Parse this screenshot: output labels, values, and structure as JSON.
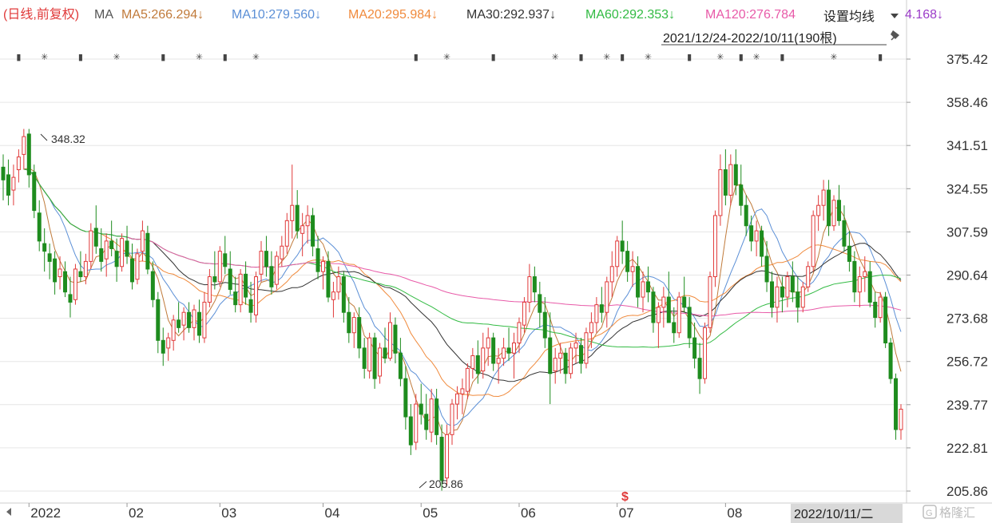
{
  "chart_data": {
    "type": "candlestick",
    "title": "(日线,前复权)",
    "ma_label": "MA",
    "ma_lines": [
      {
        "label": "MA5:266.294↓",
        "value": 266.294,
        "color": "#c07a3a"
      },
      {
        "label": "MA10:279.560↓",
        "value": 279.56,
        "color": "#5b8fd6"
      },
      {
        "label": "MA20:295.984↓",
        "value": 295.984,
        "color": "#f08a3c"
      },
      {
        "label": "MA30:292.937↓",
        "value": 292.937,
        "color": "#333333"
      },
      {
        "label": "MA60:292.353↓",
        "value": 292.353,
        "color": "#33bb44"
      },
      {
        "label": "MA120:276.784",
        "value": 276.784,
        "color": "#e85aa8"
      }
    ],
    "ma250_fragment": "4.168↓",
    "settings_label": "设置均线",
    "date_range": "2021/12/24-2022/10/11(190根)",
    "y_ticks": [
      "375.42",
      "358.46",
      "341.51",
      "324.55",
      "307.59",
      "290.64",
      "273.68",
      "256.72",
      "239.77",
      "222.81",
      "205.86"
    ],
    "ylim": [
      205.86,
      375.42
    ],
    "x_labels": [
      "2022",
      "02",
      "03",
      "04",
      "05",
      "06",
      "07",
      "08"
    ],
    "current_date_label": "2022/10/11/二",
    "high_annotation": "348.32",
    "low_annotation": "205.86",
    "dividend_mark": "$",
    "watermark": "格隆汇",
    "colors": {
      "up": "#e03a3a",
      "down": "#1e8c1e",
      "grid": "#e6e6e6",
      "axis_text": "#333333"
    },
    "candles": [
      [
        333,
        338,
        320,
        328
      ],
      [
        330,
        336,
        318,
        322
      ],
      [
        324,
        334,
        318,
        329
      ],
      [
        332,
        340,
        327,
        337
      ],
      [
        338,
        348,
        332,
        345
      ],
      [
        346,
        348,
        325,
        330
      ],
      [
        331,
        334,
        313,
        316
      ],
      [
        315,
        320,
        300,
        304
      ],
      [
        303,
        309,
        292,
        300
      ],
      [
        299,
        303,
        289,
        296
      ],
      [
        297,
        300,
        283,
        288
      ],
      [
        290,
        298,
        285,
        293
      ],
      [
        292,
        296,
        282,
        284
      ],
      [
        283,
        290,
        274,
        280
      ],
      [
        281,
        295,
        279,
        293
      ],
      [
        292,
        300,
        288,
        290
      ],
      [
        290,
        299,
        287,
        296
      ],
      [
        296,
        311,
        293,
        308
      ],
      [
        309,
        318,
        299,
        302
      ],
      [
        301,
        309,
        292,
        296
      ],
      [
        297,
        307,
        290,
        304
      ],
      [
        304,
        312,
        298,
        301
      ],
      [
        300,
        305,
        288,
        294
      ],
      [
        294,
        307,
        292,
        305
      ],
      [
        304,
        310,
        295,
        298
      ],
      [
        297,
        303,
        285,
        288
      ],
      [
        289,
        301,
        287,
        299
      ],
      [
        300,
        312,
        296,
        308
      ],
      [
        307,
        310,
        291,
        293
      ],
      [
        292,
        296,
        278,
        281
      ],
      [
        281,
        284,
        260,
        265
      ],
      [
        265,
        270,
        255,
        260
      ],
      [
        262,
        268,
        257,
        266
      ],
      [
        265,
        275,
        261,
        273
      ],
      [
        273,
        280,
        268,
        270
      ],
      [
        271,
        278,
        265,
        276
      ],
      [
        276,
        280,
        268,
        270
      ],
      [
        270,
        279,
        265,
        277
      ],
      [
        276,
        281,
        264,
        267
      ],
      [
        266,
        284,
        264,
        280
      ],
      [
        280,
        293,
        278,
        290
      ],
      [
        290,
        300,
        285,
        288
      ],
      [
        288,
        302,
        286,
        300
      ],
      [
        299,
        306,
        291,
        294
      ],
      [
        293,
        300,
        283,
        285
      ],
      [
        284,
        290,
        276,
        279
      ],
      [
        279,
        293,
        276,
        291
      ],
      [
        291,
        296,
        279,
        282
      ],
      [
        281,
        288,
        272,
        276
      ],
      [
        275,
        292,
        272,
        290
      ],
      [
        291,
        304,
        288,
        300
      ],
      [
        300,
        306,
        290,
        294
      ],
      [
        294,
        300,
        283,
        286
      ],
      [
        287,
        300,
        285,
        298
      ],
      [
        297,
        306,
        294,
        302
      ],
      [
        302,
        315,
        299,
        312
      ],
      [
        312,
        334,
        305,
        318
      ],
      [
        318,
        324,
        305,
        308
      ],
      [
        307,
        315,
        298,
        310
      ],
      [
        310,
        318,
        303,
        314
      ],
      [
        314,
        317,
        298,
        302
      ],
      [
        301,
        306,
        289,
        292
      ],
      [
        292,
        298,
        285,
        296
      ],
      [
        296,
        300,
        280,
        282
      ],
      [
        281,
        288,
        274,
        284
      ],
      [
        284,
        294,
        281,
        290
      ],
      [
        290,
        292,
        272,
        276
      ],
      [
        276,
        282,
        264,
        268
      ],
      [
        268,
        276,
        262,
        274
      ],
      [
        274,
        278,
        258,
        262
      ],
      [
        262,
        266,
        250,
        254
      ],
      [
        253,
        268,
        250,
        266
      ],
      [
        266,
        268,
        246,
        250
      ],
      [
        251,
        264,
        248,
        262
      ],
      [
        262,
        270,
        256,
        258
      ],
      [
        258,
        276,
        257,
        272
      ],
      [
        271,
        274,
        256,
        260
      ],
      [
        260,
        266,
        247,
        250
      ],
      [
        250,
        255,
        230,
        235
      ],
      [
        235,
        240,
        220,
        224
      ],
      [
        225,
        244,
        222,
        240
      ],
      [
        240,
        248,
        232,
        236
      ],
      [
        236,
        244,
        226,
        230
      ],
      [
        229,
        246,
        225,
        242
      ],
      [
        242,
        246,
        224,
        228
      ],
      [
        227,
        232,
        206,
        210
      ],
      [
        211,
        232,
        208,
        228
      ],
      [
        228,
        242,
        224,
        240
      ],
      [
        240,
        247,
        234,
        244
      ],
      [
        244,
        250,
        236,
        246
      ],
      [
        245,
        256,
        242,
        254
      ],
      [
        254,
        262,
        250,
        259
      ],
      [
        259,
        265,
        248,
        252
      ],
      [
        253,
        268,
        250,
        262
      ],
      [
        262,
        270,
        255,
        266
      ],
      [
        266,
        268,
        253,
        256
      ],
      [
        256,
        262,
        248,
        258
      ],
      [
        258,
        266,
        255,
        262
      ],
      [
        262,
        270,
        257,
        260
      ],
      [
        260,
        268,
        250,
        264
      ],
      [
        264,
        274,
        260,
        272
      ],
      [
        271,
        282,
        268,
        280
      ],
      [
        280,
        295,
        276,
        290
      ],
      [
        290,
        294,
        280,
        284
      ],
      [
        283,
        288,
        270,
        276
      ],
      [
        276,
        282,
        262,
        266
      ],
      [
        266,
        276,
        240,
        252
      ],
      [
        253,
        262,
        248,
        258
      ],
      [
        258,
        264,
        252,
        260
      ],
      [
        260,
        262,
        248,
        252
      ],
      [
        252,
        264,
        250,
        262
      ],
      [
        262,
        268,
        256,
        264
      ],
      [
        263,
        266,
        252,
        256
      ],
      [
        256,
        270,
        254,
        268
      ],
      [
        268,
        276,
        262,
        272
      ],
      [
        272,
        282,
        268,
        279
      ],
      [
        279,
        286,
        272,
        276
      ],
      [
        276,
        290,
        270,
        288
      ],
      [
        288,
        300,
        282,
        294
      ],
      [
        294,
        306,
        290,
        304
      ],
      [
        304,
        312,
        295,
        300
      ],
      [
        300,
        304,
        288,
        292
      ],
      [
        292,
        300,
        286,
        294
      ],
      [
        294,
        298,
        278,
        282
      ],
      [
        282,
        292,
        276,
        288
      ],
      [
        288,
        294,
        280,
        284
      ],
      [
        284,
        286,
        268,
        272
      ],
      [
        272,
        280,
        262,
        278
      ],
      [
        278,
        286,
        270,
        282
      ],
      [
        282,
        292,
        276,
        272
      ],
      [
        272,
        278,
        264,
        268
      ],
      [
        268,
        284,
        266,
        282
      ],
      [
        282,
        290,
        276,
        278
      ],
      [
        278,
        282,
        262,
        266
      ],
      [
        266,
        272,
        254,
        258
      ],
      [
        258,
        264,
        244,
        250
      ],
      [
        250,
        272,
        248,
        270
      ],
      [
        270,
        292,
        268,
        290
      ],
      [
        290,
        316,
        286,
        314
      ],
      [
        314,
        338,
        310,
        332
      ],
      [
        332,
        340,
        318,
        322
      ],
      [
        322,
        338,
        318,
        334
      ],
      [
        334,
        340,
        322,
        326
      ],
      [
        326,
        334,
        314,
        318
      ],
      [
        318,
        322,
        306,
        310
      ],
      [
        310,
        314,
        300,
        304
      ],
      [
        304,
        312,
        298,
        308
      ],
      [
        308,
        310,
        294,
        298
      ],
      [
        298,
        304,
        284,
        288
      ],
      [
        288,
        292,
        274,
        278
      ],
      [
        278,
        290,
        272,
        286
      ],
      [
        286,
        290,
        276,
        282
      ],
      [
        282,
        292,
        278,
        290
      ],
      [
        290,
        296,
        280,
        284
      ],
      [
        284,
        290,
        272,
        278
      ],
      [
        278,
        288,
        276,
        286
      ],
      [
        286,
        296,
        284,
        294
      ],
      [
        294,
        316,
        292,
        314
      ],
      [
        314,
        322,
        308,
        318
      ],
      [
        318,
        328,
        312,
        324
      ],
      [
        324,
        328,
        306,
        310
      ],
      [
        310,
        322,
        308,
        320
      ],
      [
        320,
        326,
        310,
        312
      ],
      [
        312,
        318,
        300,
        302
      ],
      [
        302,
        308,
        292,
        296
      ],
      [
        296,
        300,
        280,
        284
      ],
      [
        284,
        294,
        278,
        290
      ],
      [
        290,
        298,
        284,
        292
      ],
      [
        292,
        296,
        278,
        280
      ],
      [
        280,
        284,
        270,
        274
      ],
      [
        274,
        284,
        272,
        282
      ],
      [
        282,
        284,
        262,
        264
      ],
      [
        264,
        266,
        248,
        250
      ],
      [
        250,
        252,
        226,
        230
      ],
      [
        230,
        240,
        226,
        238
      ]
    ]
  }
}
